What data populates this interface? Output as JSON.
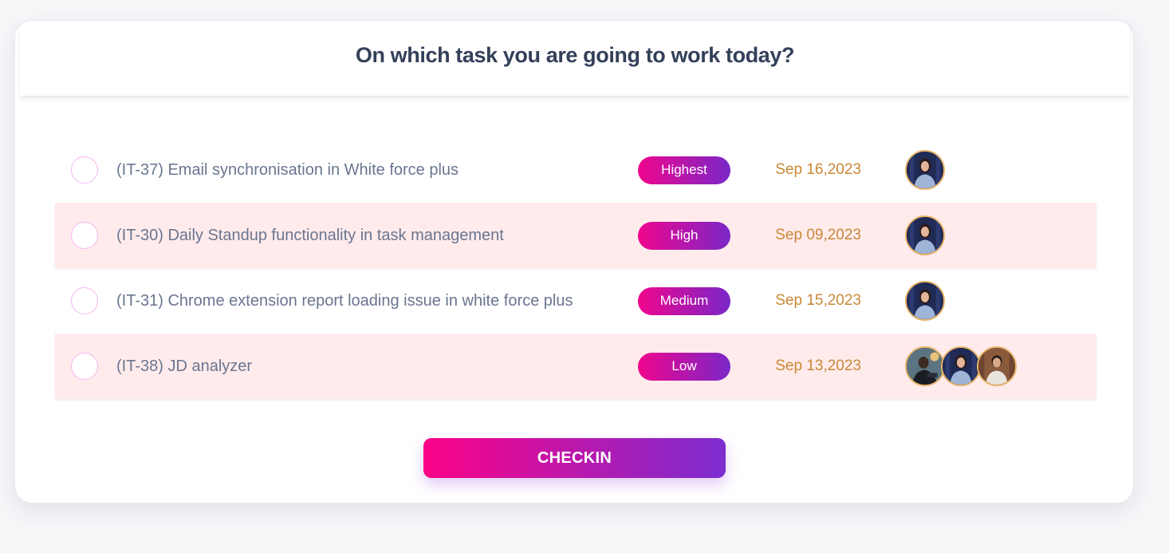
{
  "header": {
    "title": "On which task you are going to work today?"
  },
  "tasks": [
    {
      "title": "(IT-37) Email synchronisation in White force plus",
      "priority": "Highest",
      "due_date": "Sep 16,2023",
      "assignees": [
        "avatar-woman"
      ]
    },
    {
      "title": "(IT-30) Daily Standup functionality in task management",
      "priority": "High",
      "due_date": "Sep 09,2023",
      "assignees": [
        "avatar-woman"
      ]
    },
    {
      "title": "(IT-31) Chrome extension report loading issue in white force plus",
      "priority": "Medium",
      "due_date": "Sep 15,2023",
      "assignees": [
        "avatar-woman"
      ]
    },
    {
      "title": "(IT-38) JD analyzer",
      "priority": "Low",
      "due_date": "Sep 13,2023",
      "assignees": [
        "avatar-man-dark",
        "avatar-woman",
        "avatar-man-brown"
      ]
    }
  ],
  "actions": {
    "checkin_label": "CHECKIN"
  },
  "colors": {
    "title_text": "#34405a",
    "task_text": "#6a7590",
    "date_text": "#c98837",
    "row_highlight": "#ffebec",
    "badge_gradient_start": "#f0058c",
    "badge_gradient_end": "#7a27c8",
    "button_gradient_start": "#fb0287",
    "button_gradient_end": "#7b2dd0",
    "avatar_border": "#e7b467"
  }
}
